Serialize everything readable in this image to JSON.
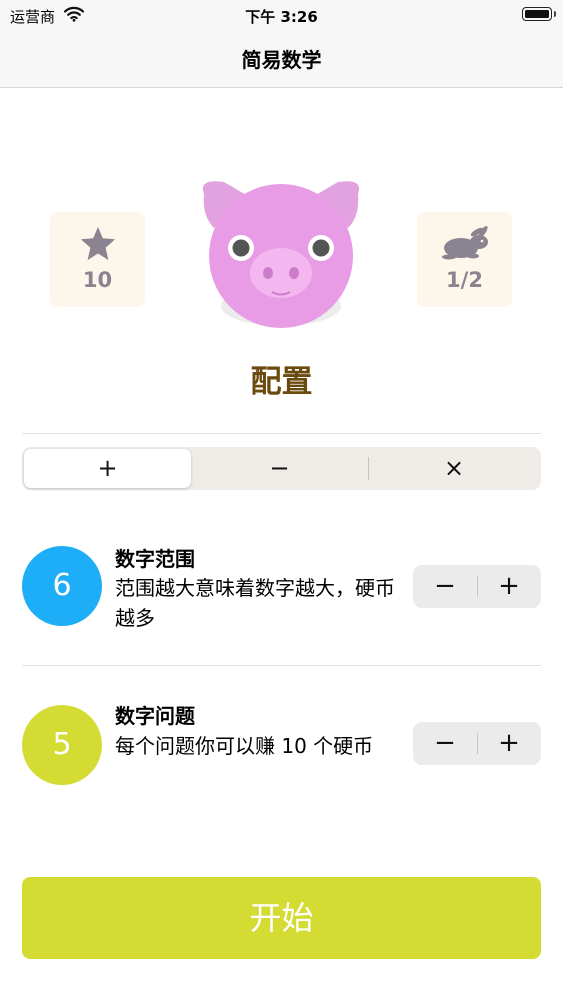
{
  "status_bar": {
    "carrier": "运营商",
    "time": "下午 3:26"
  },
  "nav": {
    "title": "简易数学"
  },
  "header": {
    "stars_icon": "star-icon",
    "stars_value": "10",
    "speed_icon": "rabbit-icon",
    "speed_value": "1/2",
    "mascot": "pig-icon",
    "config_title": "配置"
  },
  "operations": {
    "items": [
      {
        "label": "+",
        "selected": true
      },
      {
        "label": "−",
        "selected": false
      },
      {
        "label": "×",
        "selected": false
      }
    ]
  },
  "settings": [
    {
      "value": "6",
      "color": "#1eaef7",
      "title": "数字范围",
      "description": "范围越大意味着数字越大，硬币越多",
      "decrement": "−",
      "increment": "+"
    },
    {
      "value": "5",
      "color": "#d4dc34",
      "title": "数字问题",
      "description": "每个问题你可以赚 10 个硬币",
      "decrement": "−",
      "increment": "+"
    }
  ],
  "start_button": {
    "label": "开始",
    "color": "#d4dc34"
  }
}
